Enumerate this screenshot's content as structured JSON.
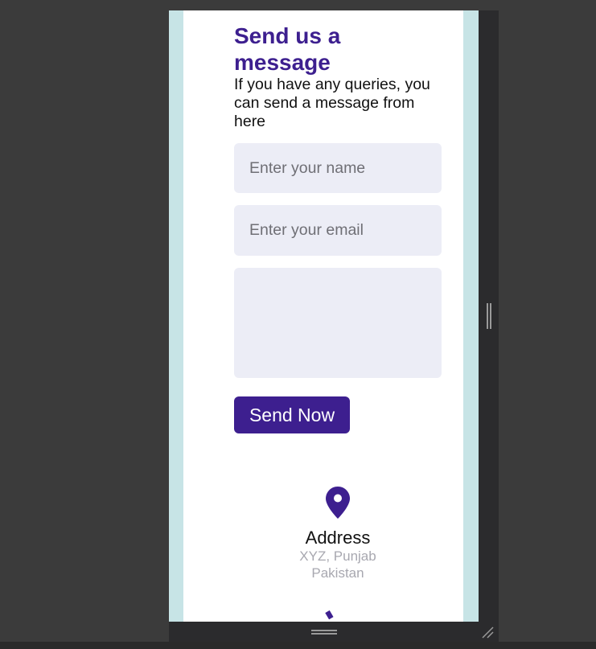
{
  "contact": {
    "title": "Send us a message",
    "subtitle": "If you have any queries, you can send a message from here",
    "name_placeholder": "Enter your name",
    "email_placeholder": "Enter your email",
    "message_placeholder": "",
    "send_label": "Send Now"
  },
  "address": {
    "icon": "map-pin-icon",
    "title": "Address",
    "line1": "XYZ, Punjab",
    "line2": "Pakistan"
  },
  "next_section": {
    "icon": "phone-icon"
  },
  "colors": {
    "accent": "#3d1f8f",
    "page_background": "#c7e4e6",
    "card_background": "#ffffff",
    "input_background": "#ecedf6",
    "muted_text": "#a8a8b0",
    "devtools_background": "#3b3b3b"
  }
}
